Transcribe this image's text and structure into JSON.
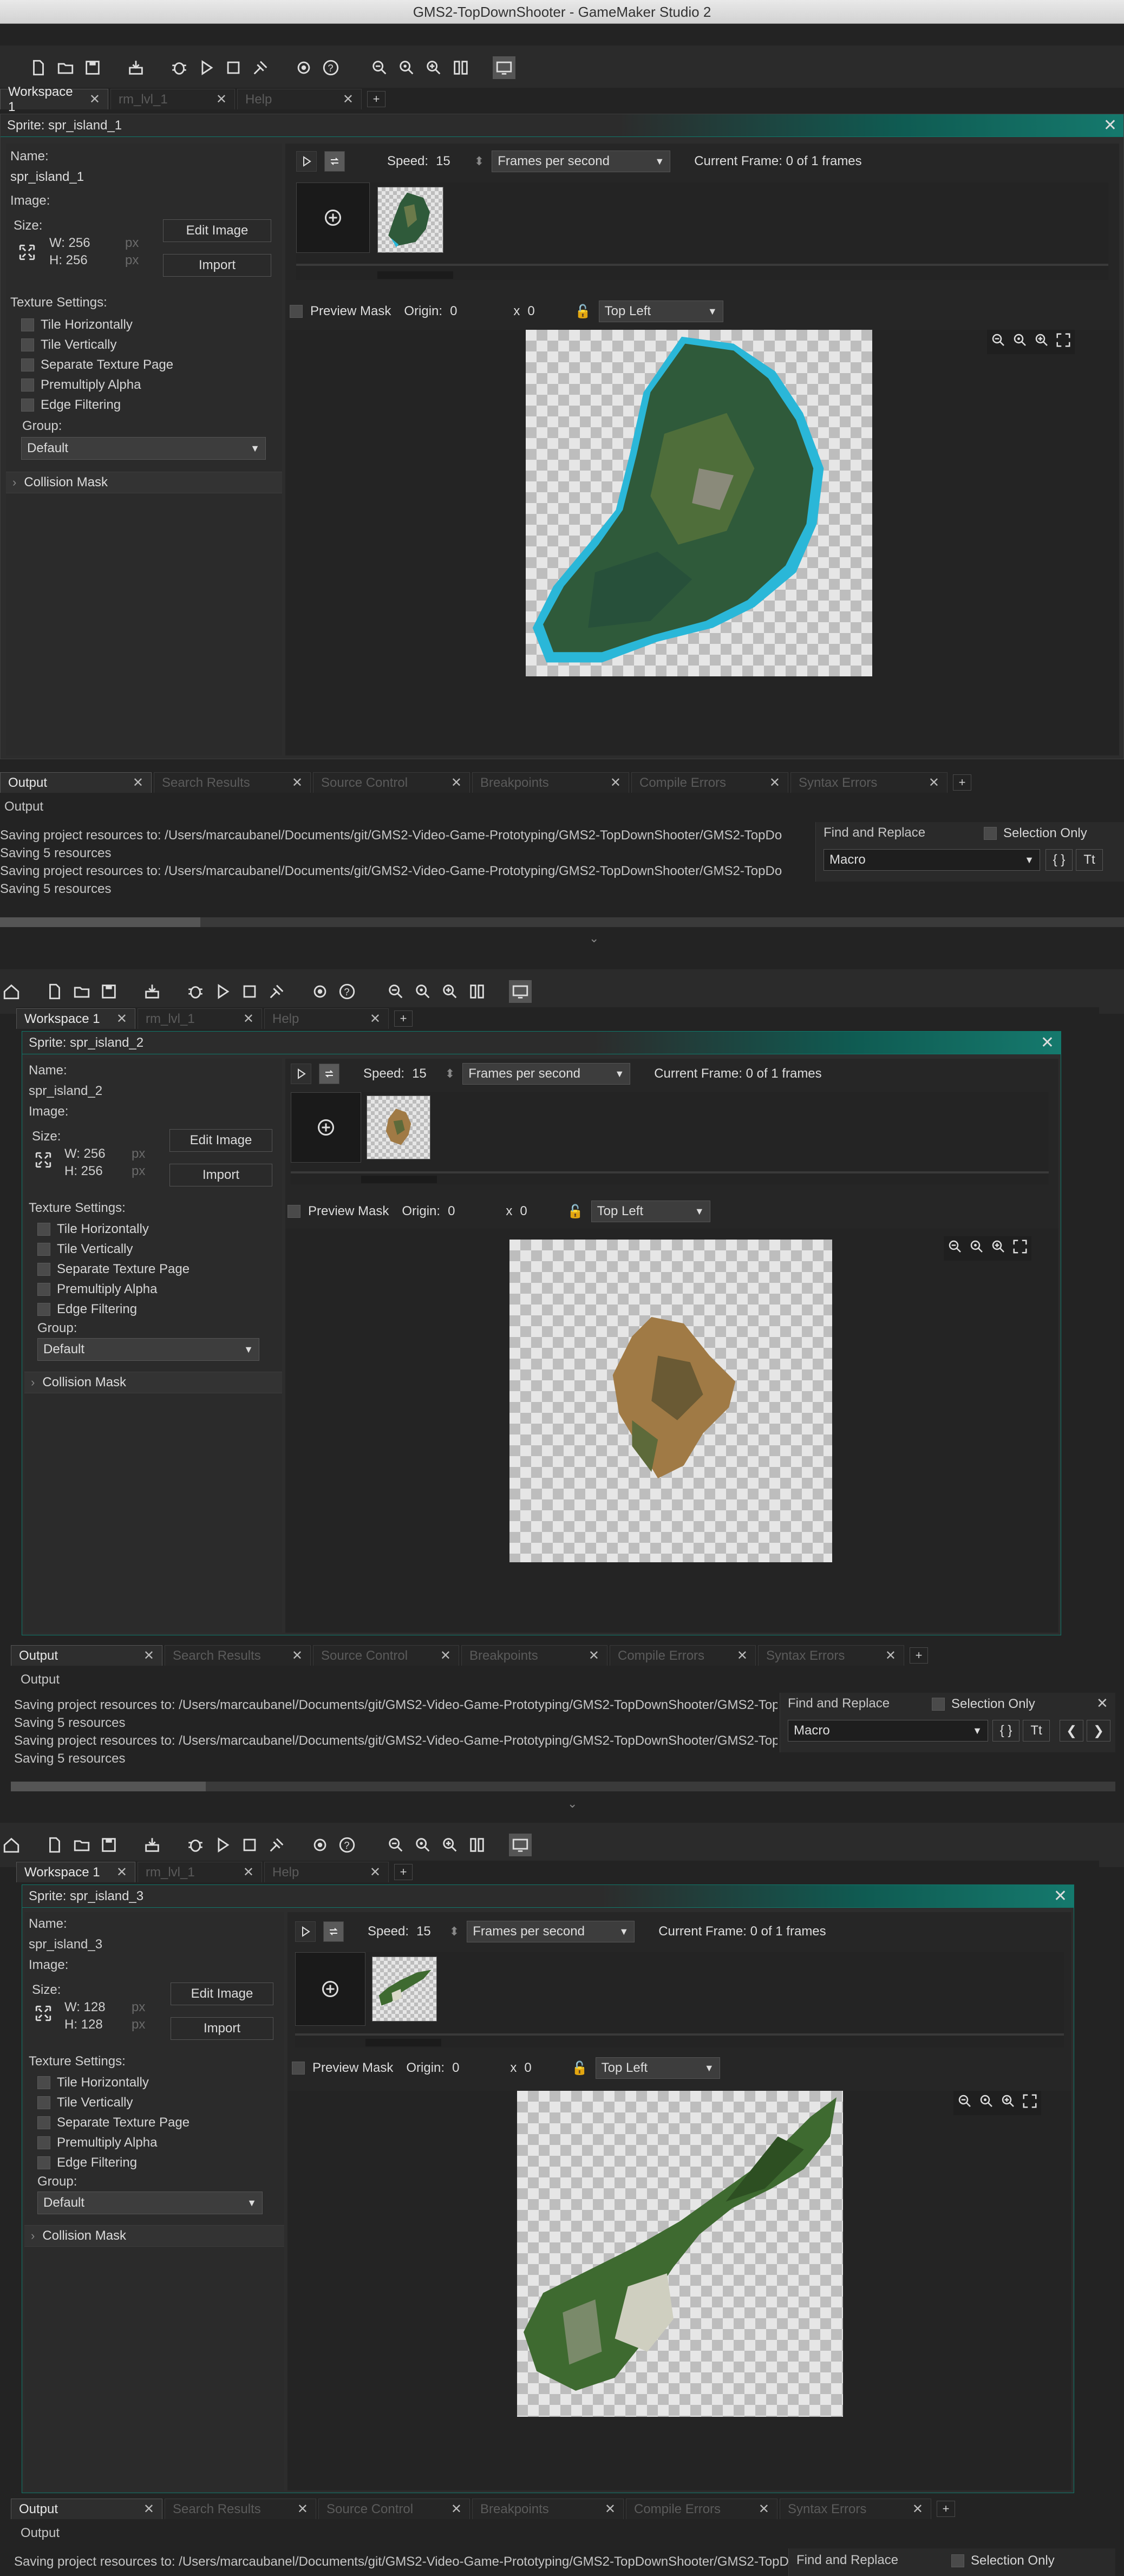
{
  "window_title": "GMS2-TopDownShooter - GameMaker Studio 2",
  "toolbar": {
    "icons": [
      "home-icon",
      "new-icon",
      "open-icon",
      "save-icon",
      "package-icon",
      "debug-icon",
      "play-icon",
      "stop-icon",
      "clean-icon",
      "settings-icon",
      "help-icon",
      "zoom-out-icon",
      "zoom-reset-icon",
      "zoom-in-icon",
      "gamepad-icon",
      "monitor-icon"
    ]
  },
  "workspace_tabs": [
    {
      "label": "Workspace 1",
      "close": "✕"
    },
    {
      "label": "rm_lvl_1",
      "close": "✕"
    },
    {
      "label": "Help",
      "close": "✕"
    }
  ],
  "add_tab": "+",
  "output_tabs": [
    {
      "label": "Output",
      "close": "✕"
    },
    {
      "label": "Search Results",
      "close": "✕"
    },
    {
      "label": "Source Control",
      "close": "✕"
    },
    {
      "label": "Breakpoints",
      "close": "✕"
    },
    {
      "label": "Compile Errors",
      "close": "✕"
    },
    {
      "label": "Syntax Errors",
      "close": "✕"
    }
  ],
  "labels": {
    "name": "Name:",
    "image": "Image:",
    "size": "Size:",
    "px": "px",
    "edit_image": "Edit Image",
    "import": "Import",
    "texture_settings": "Texture Settings:",
    "group": "Group:",
    "collision_mask": "Collision Mask",
    "speed": "Speed:",
    "preview_mask": "Preview Mask",
    "origin": "Origin:",
    "x": "x",
    "output": "Output",
    "find_replace": "Find and Replace",
    "selection_only": "Selection Only",
    "macro": "Macro",
    "braces": "{ }",
    "tt": "Tt",
    "add_frame": "+",
    "close": "✕",
    "expand_arrow": "›",
    "chevron_down": "⌄",
    "scroll_left": "❮",
    "scroll_right": "❯"
  },
  "texture_options": [
    "Tile Horizontally",
    "Tile Vertically",
    "Separate Texture Page",
    "Premultiply Alpha",
    "Edge Filtering"
  ],
  "output_lines": [
    "Saving project resources to: /Users/marcaubanel/Documents/git/GMS2-Video-Game-Prototyping/GMS2-TopDownShooter/GMS2-TopDo",
    "Saving 5 resources",
    "Saving project resources to: /Users/marcaubanel/Documents/git/GMS2-Video-Game-Prototyping/GMS2-TopDownShooter/GMS2-TopDo",
    "Saving 5 resources"
  ],
  "sprites": [
    {
      "title": "Sprite: spr_island_1",
      "name": "spr_island_1",
      "w": "W: 256",
      "h": "H: 256",
      "speed": "15",
      "speed_unit": "Frames per second",
      "current_frame": "Current Frame: 0 of 1 frames",
      "origin_x": "0",
      "origin_y": "0",
      "origin_preset": "Top Left",
      "group": "Default"
    },
    {
      "title": "Sprite: spr_island_2",
      "name": "spr_island_2",
      "w": "W: 256",
      "h": "H: 256",
      "speed": "15",
      "speed_unit": "Frames per second",
      "current_frame": "Current Frame: 0 of 1 frames",
      "origin_x": "0",
      "origin_y": "0",
      "origin_preset": "Top Left",
      "group": "Default"
    },
    {
      "title": "Sprite: spr_island_3",
      "name": "spr_island_3",
      "w": "W: 128",
      "h": "H: 128",
      "speed": "15",
      "speed_unit": "Frames per second",
      "current_frame": "Current Frame: 0 of 1 frames",
      "origin_x": "0",
      "origin_y": "0",
      "origin_preset": "Top Left",
      "group": "Default"
    }
  ],
  "colors": {
    "accent_teal": "#15796d",
    "island_1": "#2f5a3a",
    "island_2": "#a07a45",
    "island_3": "#3e6a30",
    "mask_cyan": "#2ab7d8"
  }
}
